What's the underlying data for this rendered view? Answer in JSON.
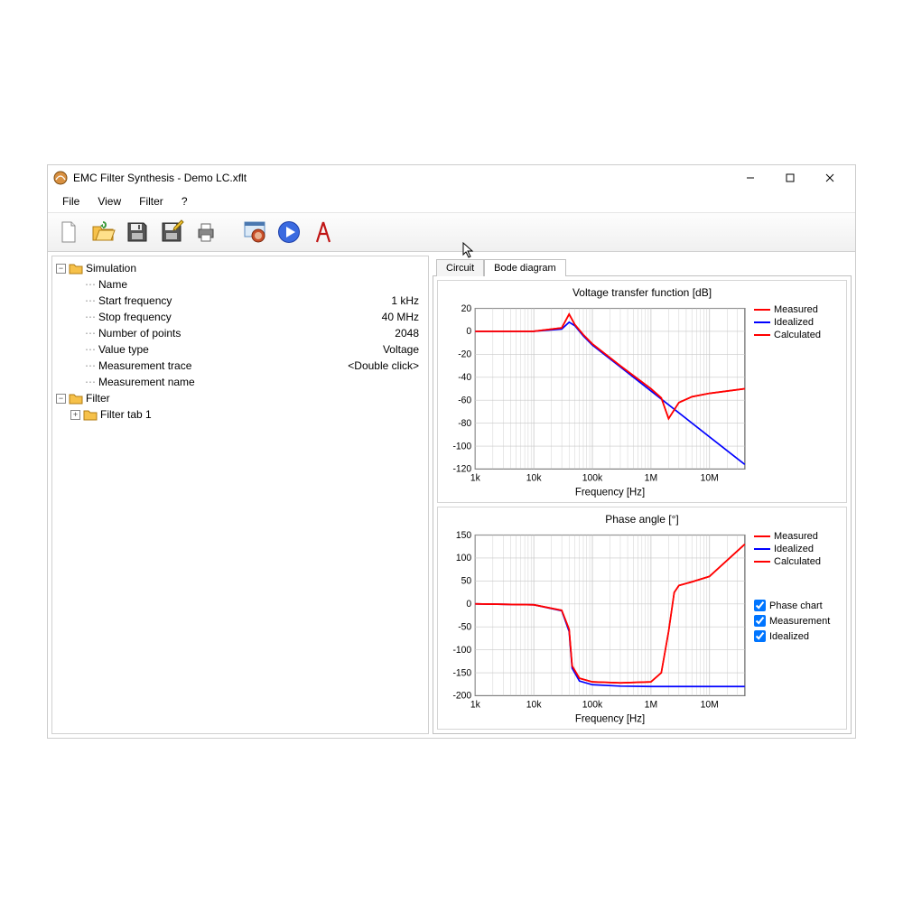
{
  "window": {
    "title": "EMC Filter Synthesis - Demo LC.xflt"
  },
  "menu": {
    "file": "File",
    "view": "View",
    "filter": "Filter",
    "help": "?"
  },
  "tree": {
    "simulation_label": "Simulation",
    "filter_label": "Filter",
    "filter_tab1": "Filter tab 1",
    "props": {
      "name": {
        "label": "Name",
        "value": ""
      },
      "start_freq": {
        "label": "Start frequency",
        "value": "1 kHz"
      },
      "stop_freq": {
        "label": "Stop frequency",
        "value": "40 MHz"
      },
      "num_points": {
        "label": "Number of points",
        "value": "2048"
      },
      "value_type": {
        "label": "Value type",
        "value": "Voltage"
      },
      "meas_trace": {
        "label": "Measurement trace",
        "value": "<Double click>"
      },
      "meas_name": {
        "label": "Measurement name",
        "value": ""
      }
    }
  },
  "tabs": {
    "circuit": "Circuit",
    "bode": "Bode diagram"
  },
  "legend": {
    "measured": "Measured",
    "idealized": "Idealized",
    "calculated": "Calculated"
  },
  "checkboxes": {
    "phase_chart": "Phase chart",
    "measurement": "Measurement",
    "idealized": "Idealized"
  },
  "colors": {
    "measured": "#ff0000",
    "idealized": "#0000ff",
    "calculated": "#ff0000",
    "grid": "#c8c8c8",
    "axis": "#000"
  },
  "chart_data": [
    {
      "type": "line",
      "title": "Voltage transfer function [dB]",
      "xlabel": "Frequency [Hz]",
      "ylabel": "",
      "xscale": "log",
      "xlim": [
        1000,
        40000000
      ],
      "ylim": [
        -120,
        20
      ],
      "xticks": [
        1000,
        10000,
        100000,
        1000000,
        10000000
      ],
      "xtick_labels": [
        "1k",
        "10k",
        "100k",
        "1M",
        "10M"
      ],
      "yticks": [
        -120,
        -100,
        -80,
        -60,
        -40,
        -20,
        0,
        20
      ],
      "series": [
        {
          "name": "Idealized",
          "color": "#0000ff",
          "x": [
            1000,
            10000,
            30000,
            40000,
            50000,
            70000,
            100000,
            300000,
            1000000,
            3000000,
            10000000,
            40000000
          ],
          "y": [
            0,
            0,
            2,
            8,
            5,
            -4,
            -12,
            -31,
            -52,
            -71,
            -92,
            -116
          ]
        },
        {
          "name": "Measured",
          "color": "#ff0000",
          "x": [
            1000,
            10000,
            30000,
            40000,
            50000,
            70000,
            100000,
            300000,
            1000000,
            1500000,
            2000000,
            3000000,
            5000000,
            10000000,
            40000000
          ],
          "y": [
            0,
            0,
            3,
            15,
            6,
            -3,
            -11,
            -30,
            -50,
            -58,
            -76,
            -62,
            -57,
            -54,
            -50
          ]
        },
        {
          "name": "Calculated",
          "color": "#ff0000",
          "x": [
            1000,
            10000,
            30000,
            40000,
            50000,
            70000,
            100000,
            300000,
            1000000,
            1500000,
            2000000,
            3000000,
            5000000,
            10000000,
            40000000
          ],
          "y": [
            0,
            0,
            3,
            15,
            6,
            -3,
            -11,
            -30,
            -50,
            -58,
            -76,
            -62,
            -57,
            -54,
            -50
          ]
        }
      ]
    },
    {
      "type": "line",
      "title": "Phase angle [°]",
      "xlabel": "Frequency [Hz]",
      "ylabel": "",
      "xscale": "log",
      "xlim": [
        1000,
        40000000
      ],
      "ylim": [
        -200,
        150
      ],
      "xticks": [
        1000,
        10000,
        100000,
        1000000,
        10000000
      ],
      "xtick_labels": [
        "1k",
        "10k",
        "100k",
        "1M",
        "10M"
      ],
      "yticks": [
        -200,
        -150,
        -100,
        -50,
        0,
        50,
        100,
        150
      ],
      "series": [
        {
          "name": "Idealized",
          "color": "#0000ff",
          "x": [
            1000,
            10000,
            30000,
            40000,
            45000,
            60000,
            100000,
            300000,
            1000000,
            3000000,
            10000000,
            40000000
          ],
          "y": [
            0,
            -2,
            -15,
            -60,
            -140,
            -168,
            -176,
            -179,
            -180,
            -180,
            -180,
            -180
          ]
        },
        {
          "name": "Measured",
          "color": "#ff0000",
          "x": [
            1000,
            10000,
            30000,
            40000,
            45000,
            60000,
            100000,
            300000,
            1000000,
            1500000,
            2000000,
            2500000,
            3000000,
            5000000,
            10000000,
            40000000
          ],
          "y": [
            0,
            -2,
            -14,
            -55,
            -135,
            -162,
            -170,
            -172,
            -170,
            -150,
            -60,
            25,
            40,
            48,
            60,
            130
          ]
        },
        {
          "name": "Calculated",
          "color": "#ff0000",
          "x": [
            1000,
            10000,
            30000,
            40000,
            45000,
            60000,
            100000,
            300000,
            1000000,
            1500000,
            2000000,
            2500000,
            3000000,
            5000000,
            10000000,
            40000000
          ],
          "y": [
            0,
            -2,
            -14,
            -55,
            -135,
            -162,
            -170,
            -172,
            -170,
            -150,
            -60,
            25,
            40,
            48,
            60,
            130
          ]
        }
      ]
    }
  ]
}
